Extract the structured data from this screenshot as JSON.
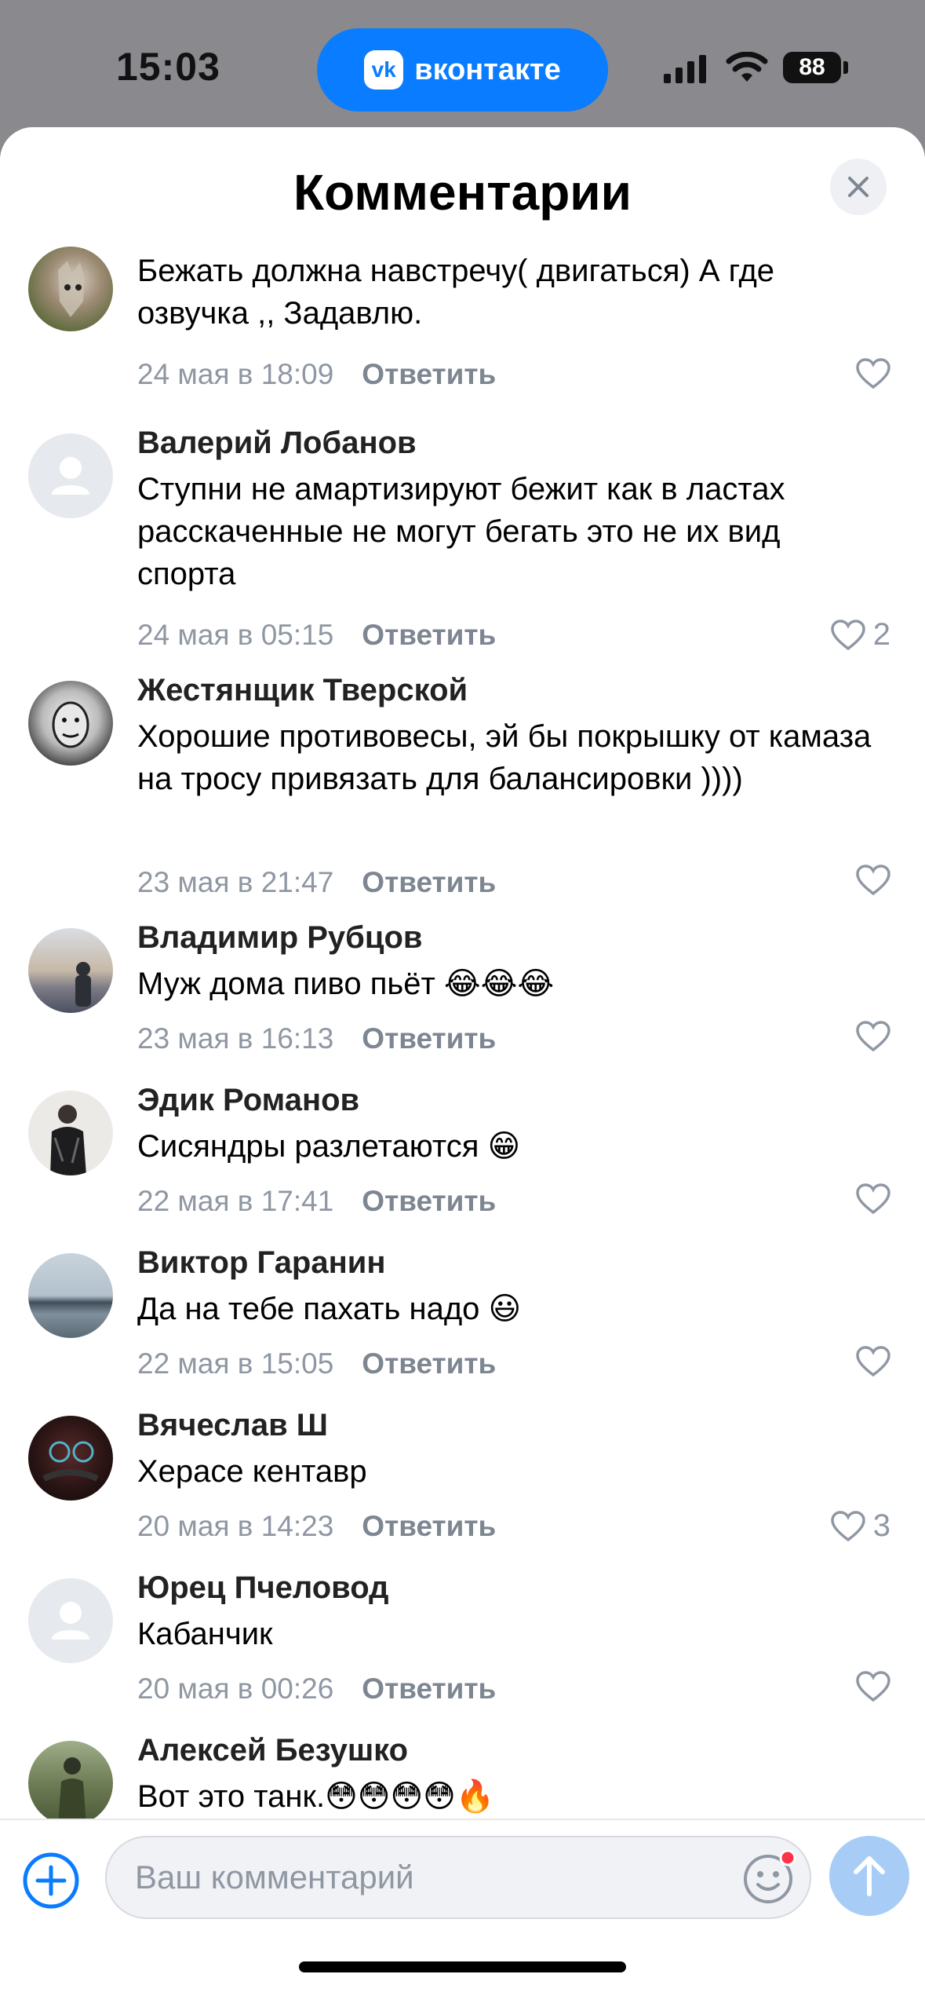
{
  "status_bar": {
    "time": "15:03",
    "app_pill_label": "вконтакте",
    "vk_logo_text": "vk",
    "battery": "88"
  },
  "sheet": {
    "title": "Комментарии"
  },
  "comments": [
    {
      "name": "",
      "text": "Бежать должна навстречу( двигаться) А где озвучка ,, Задавлю.",
      "date": "24 мая в 18:09",
      "reply": "Ответить",
      "likes": "",
      "avatar": "wolf-photo"
    },
    {
      "name": "Валерий Лобанов",
      "text": "Ступни не амартизируют бежит как в ластах расскаченные не могут бегать это не их вид спорта",
      "date": "24 мая в 05:15",
      "reply": "Ответить",
      "likes": "2",
      "avatar": "default"
    },
    {
      "name": "Жестянщик Тверской",
      "text": "Хорошие противовесы, эй бы покрышку от камаза на тросу привязать для балансировки ))))",
      "date": "23 мая в 21:47",
      "reply": "Ответить",
      "likes": "",
      "avatar": "sketch-face"
    },
    {
      "name": "Владимир Рубцов",
      "text": "Муж дома пиво пьёт 😂😂😂",
      "date": "23 мая в 16:13",
      "reply": "Ответить",
      "likes": "",
      "avatar": "sunset-man"
    },
    {
      "name": "Эдик Романов",
      "text": "Сисяндры разлетаются 😁",
      "date": "22 мая в 17:41",
      "reply": "Ответить",
      "likes": "",
      "avatar": "man-black-shirt"
    },
    {
      "name": "Виктор Гаранин",
      "text": "Да на тебе пахать надо 😃",
      "date": "22 мая в 15:05",
      "reply": "Ответить",
      "likes": "",
      "avatar": "lake"
    },
    {
      "name": "Вячеслав Ш",
      "text": "Херасе кентавр",
      "date": "20 мая в 14:23",
      "reply": "Ответить",
      "likes": "3",
      "avatar": "car-dashboard"
    },
    {
      "name": "Юрец Пчеловод",
      "text": "Кабанчик",
      "date": "20 мая в 00:26",
      "reply": "Ответить",
      "likes": "",
      "avatar": "default"
    },
    {
      "name": "Алексей Безушко",
      "text": "Вот это танк.😳😳😳😳🔥",
      "date": "",
      "reply": "",
      "likes": "",
      "avatar": "forest-man"
    }
  ],
  "input": {
    "placeholder": "Ваш комментарий"
  },
  "colors": {
    "accent": "#0a7cff",
    "send_disabled": "#a7cdf7",
    "meta": "#8f97a3"
  }
}
